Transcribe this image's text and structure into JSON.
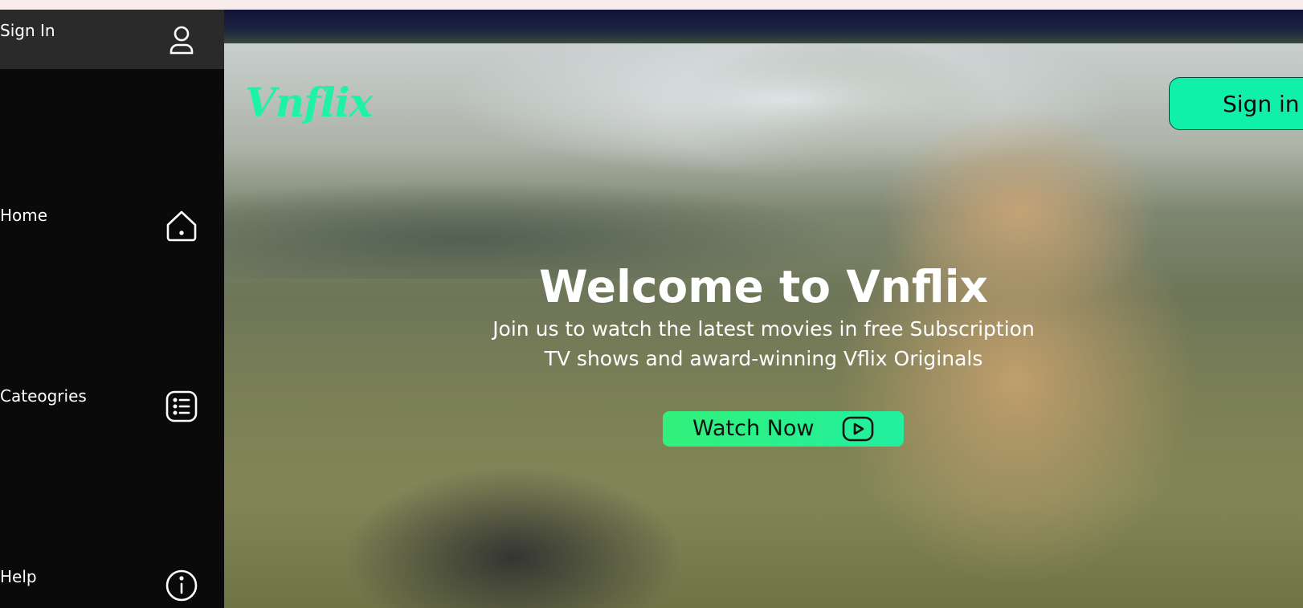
{
  "sidebar": {
    "items": [
      {
        "label": "Sign In",
        "icon": "user-icon"
      },
      {
        "label": "Home",
        "icon": "home-icon"
      },
      {
        "label": "Cateogries",
        "icon": "list-icon"
      },
      {
        "label": "Help",
        "icon": "info-icon"
      }
    ]
  },
  "header": {
    "logo": "Vnflix",
    "signin_label": "Sign in"
  },
  "hero": {
    "title": "Welcome to Vnflix",
    "subtitle_line1": "Join us to watch the latest movies in free Subscription",
    "subtitle_line2": "TV shows and award-winning Vflix Originals",
    "cta_label": "Watch Now",
    "cta_icon": "play-icon"
  },
  "colors": {
    "accent": "#1ff2a6",
    "sidebar_bg": "#0a0a0a",
    "sidebar_active_bg": "#2a2a2a"
  }
}
